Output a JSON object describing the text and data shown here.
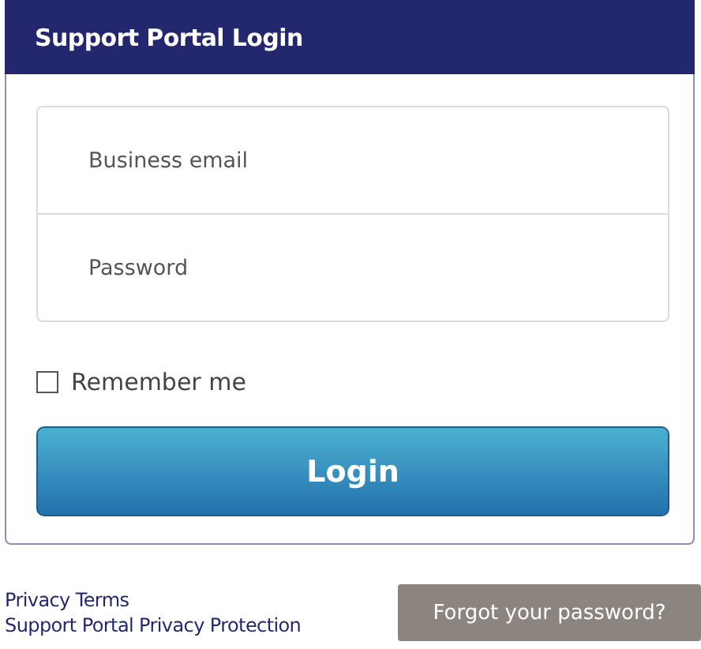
{
  "header": {
    "title": "Support Portal Login"
  },
  "fields": [
    {
      "placeholder": "Business email"
    },
    {
      "placeholder": "Password"
    }
  ],
  "remember": {
    "label": "Remember me",
    "checked": false
  },
  "login_button": "Login",
  "links": [
    "Privacy Terms",
    "Support Portal Privacy Protection"
  ],
  "forgot_button": "Forgot your password?"
}
